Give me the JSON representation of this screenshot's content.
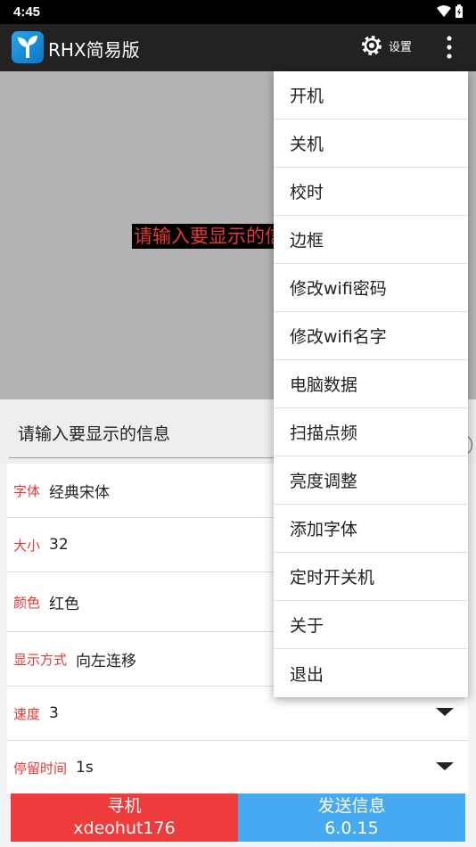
{
  "status": {
    "time": "4:45"
  },
  "appbar": {
    "title": "RHX简易版",
    "settings_label": "设置"
  },
  "preview": {
    "text": "请输入要显示的信息"
  },
  "message": {
    "placeholder": "请输入要显示的信息"
  },
  "settings": [
    {
      "label": "字体",
      "value": "经典宋体"
    },
    {
      "label": "大小",
      "value": "32"
    },
    {
      "label": "颜色",
      "value": "红色"
    },
    {
      "label": "显示方式",
      "value": "向左连移"
    },
    {
      "label": "速度",
      "value": "3"
    },
    {
      "label": "停留时间",
      "value": "1s"
    }
  ],
  "buttons": {
    "find": {
      "label": "寻机",
      "sub": "xdeohut176"
    },
    "send": {
      "label": "发送信息",
      "sub": "6.0.15"
    }
  },
  "menu": [
    "开机",
    "关机",
    "校时",
    "边框",
    "修改wifi密码",
    "修改wifi名字",
    "电脑数据",
    "扫描点频",
    "亮度调整",
    "添加字体",
    "定时开关机",
    "关于",
    "退出"
  ]
}
